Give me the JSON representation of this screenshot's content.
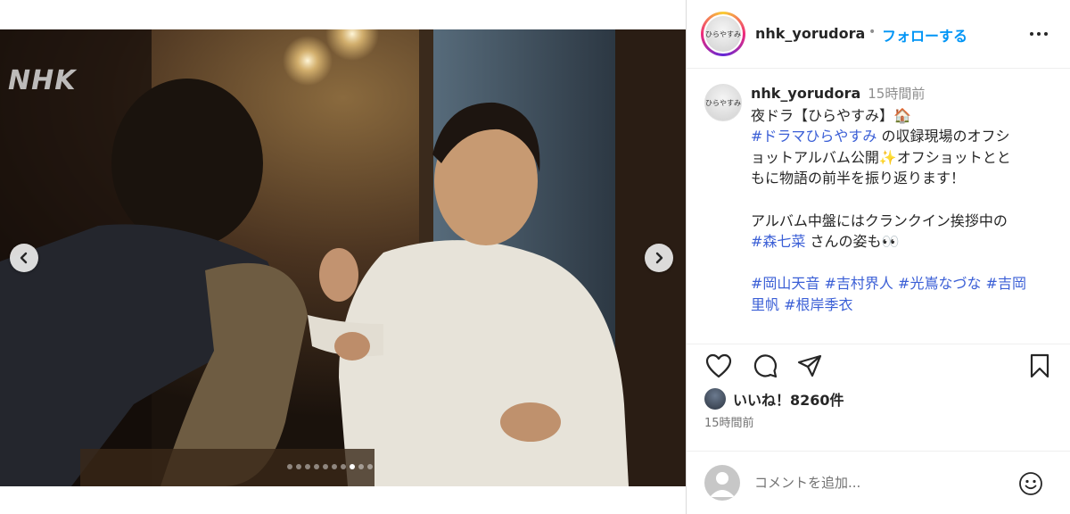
{
  "media": {
    "watermark": "NHK",
    "carousel": {
      "total": 10,
      "active_index": 7
    }
  },
  "header": {
    "username": "nhk_yorudora",
    "separator": "•",
    "follow_label": "フォローする",
    "avatar_text": "ひらやすみ"
  },
  "caption": {
    "username": "nhk_yorudora",
    "time": "15時間前",
    "lines": {
      "l1": "夜ドラ【ひらやすみ】🏠",
      "l2_tag": "#ドラマひらやすみ",
      "l2_text": " の収録現場のオフシ",
      "l3": "ョットアルバム公開✨オフショットとと",
      "l4": "もに物語の前半を振り返ります！",
      "l5": "アルバム中盤にはクランクイン挨拶中の",
      "l6_tag": "#森七菜",
      "l6_text": " さんの姿も👀",
      "l7_tags": [
        "#岡山天音",
        "#吉村界人",
        "#光嶌なづな",
        "#吉岡"
      ],
      "l8_tags": [
        "里帆",
        "#根岸季衣"
      ]
    }
  },
  "stats": {
    "likes_label": "いいね！8260件",
    "time": "15時間前"
  },
  "comment": {
    "placeholder": "コメントを追加..."
  },
  "colors": {
    "accent": "#0095f6",
    "hashtag": "#3b5fd6",
    "muted": "#8e8e8e"
  }
}
